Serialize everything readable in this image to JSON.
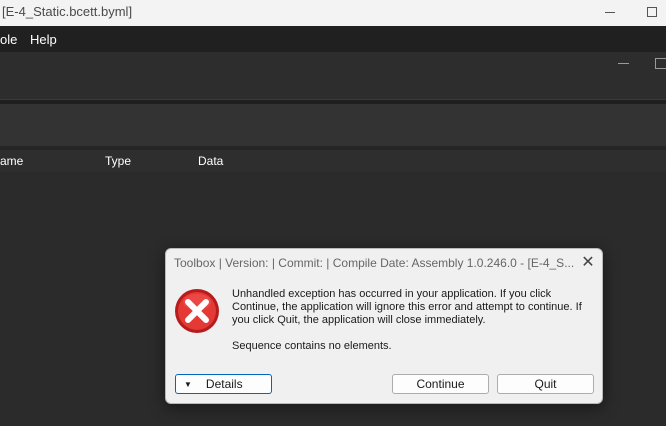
{
  "window": {
    "title": "[E-4_Static.bcett.byml]"
  },
  "menu": {
    "items": [
      "ole",
      "Help"
    ]
  },
  "table": {
    "columns": [
      "ame",
      "Type",
      "Data"
    ]
  },
  "dialog": {
    "title": "Toolbox | Version:  | Commit:  | Compile Date:  Assembly 1.0.246.0 - [E-4_S...",
    "message": "Unhandled exception has occurred in your application. If you click Continue, the application will ignore this error and attempt to continue. If you click Quit, the application will close immediately.",
    "detail": "Sequence contains no elements.",
    "buttons": {
      "details": "Details",
      "continue": "Continue",
      "quit": "Quit"
    },
    "icon": "error-icon"
  },
  "colors": {
    "error_red": "#c62828",
    "focus_blue": "#0067c0"
  }
}
